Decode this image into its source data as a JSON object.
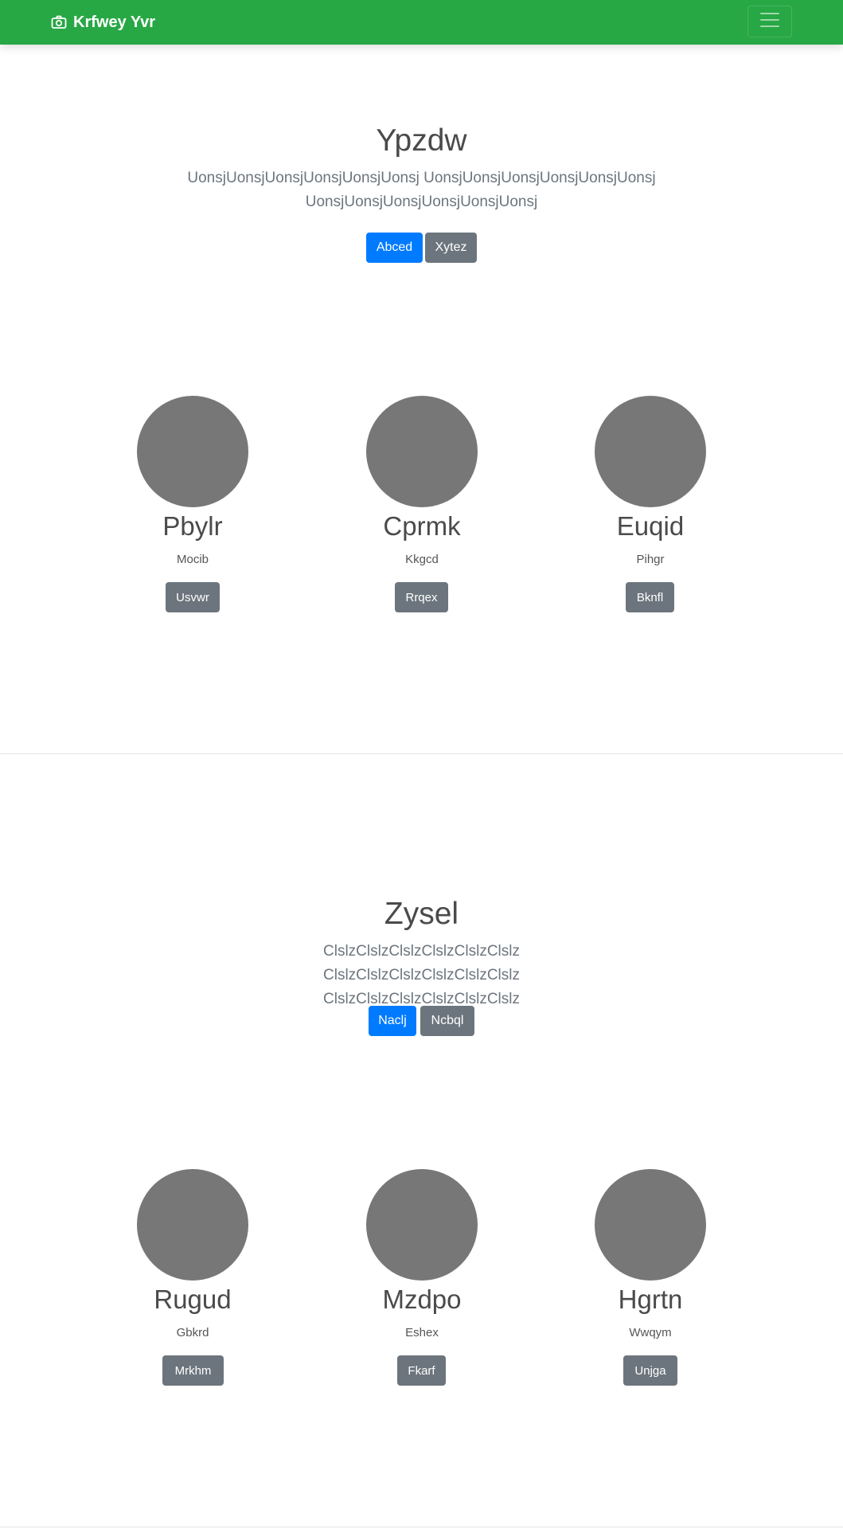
{
  "navbar": {
    "brand": "Krfwey Yvr",
    "brand_icon": "camera-icon",
    "toggler_icon": "hamburger-icon",
    "color": "#28a745"
  },
  "sections": [
    {
      "title": "Ypzdw",
      "lead": "UonsjUonsjUonsjUonsjUonsjUonsj UonsjUonsjUonsjUonsjUonsjUonsj UonsjUonsjUonsjUonsjUonsjUonsj",
      "primary_button": "Abced",
      "secondary_button": "Xytez",
      "cards": [
        {
          "name": "Pbylr",
          "sub": "Mocib",
          "button": "Usvwr"
        },
        {
          "name": "Cprmk",
          "sub": "Kkgcd",
          "button": "Rrqex"
        },
        {
          "name": "Euqid",
          "sub": "Pihgr",
          "button": "Bknfl"
        }
      ]
    },
    {
      "title": "Zysel",
      "lead": "ClslzClslzClslzClslzClslzClslz ClslzClslzClslzClslzClslzClslz ClslzClslzClslzClslzClslzClslz",
      "primary_button": "Naclj",
      "secondary_button": "Ncbql",
      "cards": [
        {
          "name": "Rugud",
          "sub": "Gbkrd",
          "button": "Mrkhm"
        },
        {
          "name": "Mzdpo",
          "sub": "Eshex",
          "button": "Fkarf"
        },
        {
          "name": "Hgrtn",
          "sub": "Wwqym",
          "button": "Unjga"
        }
      ]
    }
  ],
  "colors": {
    "primary": "#007bff",
    "secondary": "#6c757d",
    "avatar": "#777777"
  }
}
